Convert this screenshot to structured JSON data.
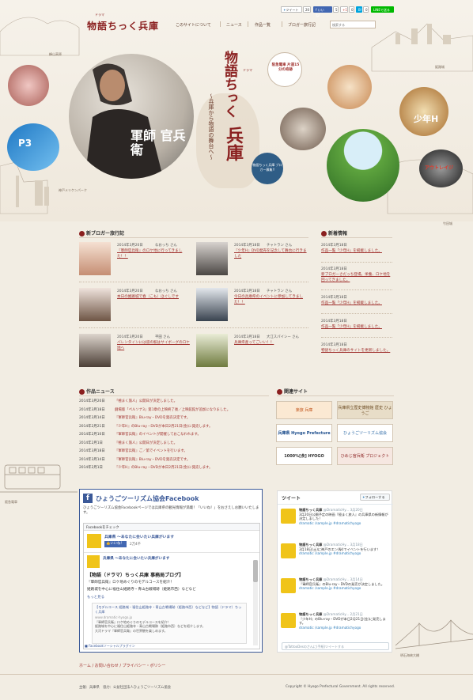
{
  "header": {
    "logo": "物語ちっく兵庫",
    "logo_ruby": "ドラマ",
    "nav": [
      "このサイトについて",
      "ニュース",
      "作品一覧",
      "ブロガー旅行記"
    ],
    "search_placeholder": "検索する",
    "social": {
      "tweet": "ツイート",
      "tweet_count": "20",
      "fb_like": "いいね！",
      "fb_count": "5",
      "gplus": "+1",
      "gplus_count": "0",
      "hatena": "B!",
      "hatena_count": "0",
      "line": "LINEで送る"
    }
  },
  "hero": {
    "title": "物語ちっく",
    "title_ruby": "ドラマ",
    "title_big": "兵庫",
    "subtitle": "〜兵庫から物語の舞台へ〜",
    "blog_badge": "物語ちっく兵庫 ブロガー募集!!",
    "main_title_art": "軍師 官兵衛",
    "poster_hankyu": "阪急電車 片道15分の奇跡",
    "poster_shonen": "少年H",
    "poster_outrage": "アウトレイジ",
    "poster_p3": "P3",
    "labels": {
      "rokko": "峰山高原",
      "himeji": "姫路城",
      "kobe": "神戸メリケンパーク",
      "takeda": "竹田城",
      "hankyu": "阪急電車",
      "akashi": "明石海峡大橋"
    }
  },
  "blogger": {
    "heading": "新ブロガー旅行記",
    "posts": [
      {
        "date": "2014年3月20日",
        "author": "なおっち さん",
        "title": "『軍師官兵衛』のロケ地に行ってきました！！"
      },
      {
        "date": "2014年3月18日",
        "author": "チャトラン さん",
        "title": "『少年H』DVD発売を記念して舞台に行きました"
      },
      {
        "date": "2014年3月20日",
        "author": "なおっち さん",
        "title": "本日の姫路城で春（こも）ほぐしです"
      },
      {
        "date": "2014年3月18日",
        "author": "チャトラン さん",
        "title": "今日の兵庫県のイベントに参加してきました！！"
      },
      {
        "date": "2014年3月20日",
        "author": "平田 さん",
        "title": "バレンタインには道の駅はサイボーグのロケ地へ"
      },
      {
        "date": "2014年3月18日",
        "author": "大江スパイシー さん",
        "title": "兵庫県産ってごいい！！"
      }
    ]
  },
  "info": {
    "heading": "新着情報",
    "items": [
      {
        "date": "2014年3月18日",
        "text": "作品一覧「少年H」を掲載しました。"
      },
      {
        "date": "2014年3月18日",
        "text": "新ブロガーさだっち登場。栄養、ロケ地を回ってきました。"
      },
      {
        "date": "2014年3月18日",
        "text": "作品一覧「少年H」を掲載しました。"
      },
      {
        "date": "2014年3月18日",
        "text": "作品一覧「少年H」を掲載しました。"
      },
      {
        "date": "2014年3月18日",
        "text": "物語ちっく兵庫のサイトを更新しました。"
      }
    ]
  },
  "news": {
    "heading": "作品ニュース",
    "rows": [
      {
        "date": "2014年3月20日",
        "text": "「極まく旅人」公開日が決定しました。"
      },
      {
        "date": "2014年3月18日",
        "text": "劇場版「ペルソナ3」第1章の上映終了後／上映館館が追加になりました。"
      },
      {
        "date": "2014年3月14日",
        "text": "『軍師官兵衛』Blu-ray・DVDを発売決定です。"
      },
      {
        "date": "2014年2月21日",
        "text": "『少年H』のBlu-ray・DVDが本日2月21日(金)に発売します。"
      },
      {
        "date": "2014年2月10日",
        "text": "『軍師官兵衛』のイベントが開催しておこなわれます。"
      },
      {
        "date": "2014年2月1日",
        "text": "『極まく旅人』公開日が決定しました。"
      },
      {
        "date": "2014年3月18日",
        "text": "『軍師官兵衛』ご／第でイベントを行います。"
      },
      {
        "date": "2014年3月14日",
        "text": "『軍師官兵衛』Blu-ray・DVDを発売決定です。"
      },
      {
        "date": "2014年2月1日",
        "text": "『少年H』のBlu-ray・DVDが本日2月21日(金)に発売します。"
      }
    ]
  },
  "links": {
    "heading": "関連サイト",
    "banners": [
      "楽旅 兵庫",
      "兵庫県立歴史博物館 歴史 ひょうご",
      "兵庫県 Hyogo Prefecture",
      "ひょうごツーリズム協会",
      "1000%[食] HYOGO",
      "ひめじ官兵衛 プロジェクト"
    ]
  },
  "facebook": {
    "title": "ひょうごツーリズム協会Facebook",
    "desc": "ひょうごツーリズム協会Facebookページでは兵庫県の観光情報が満載！「いいね！」をおさえしお願いいたします。",
    "plugin_head": "Facebookをチェック",
    "page_name": "兵庫県 〜あなたに会いたい兵庫がいます",
    "like_label": "いいね！",
    "like_count": "2万4千",
    "post_author": "兵庫県 〜あなたに会いたい兵庫がいます",
    "post_title": "【物語（ドラマ）ちっく兵庫 事務局ブログ】",
    "post_body1": "『軍師官兵衛』ロケ地めぐりのモデルコースを紹介！",
    "post_body2": "姫路城を中心に福住山姫路寺・青山古戦場跡（姫路市西）などなど",
    "more": "もっと見る",
    "card_title": "【モデルコース 姫路城・福住山姫路寺・青山古戦場跡（姫路市西）などなど】物語（ドラマ）ちっく兵庫",
    "card_url": "www.dramatic-hyogo.jp",
    "card_text1": "『軍師官兵衛』ロケ地めぐりのモデルコースを紹介！",
    "card_text2": "姫路城を中心に福住山姫路寺・青山古戦場跡（姫路市西）などを紹介します。",
    "card_text3": "大河ドラマ『軍師官兵衛』の世界観を楽しめます。",
    "footer": "Facebookソーシャルプラグイン"
  },
  "twitter": {
    "heading": "ツイート",
    "follow": "フォローする",
    "tweets": [
      {
        "name": "物語ちっく兵庫",
        "handle": "@DramaticHy...",
        "date": "3月20日",
        "text": "3月20日公開予定の映画『極まく旅人』の兵庫県の新情報が決定しました！",
        "link": "dramatic /sample.jp",
        "tag": "#dramatichyogo"
      },
      {
        "name": "物語ちっく兵庫",
        "handle": "@DramaticHy...",
        "date": "3月18日",
        "text": "3月18日(土)に神戸のエン(駅)でイベントを行います！",
        "link": "dramatic /sample.jp",
        "tag": "#dramatichyogo"
      },
      {
        "name": "物語ちっく兵庫",
        "handle": "@DramaticHy...",
        "date": "3月14日",
        "text": "『軍師官兵衛』のBlu-ray・DVDの発売が決定しました。",
        "link": "dramatic /sample.jp",
        "tag": "#dramatichyogo"
      },
      {
        "name": "物語ちっく兵庫",
        "handle": "@DramaticHy...",
        "date": "2月21日",
        "text": "『少年H』のBlu-ray・DVDが本日2月21日(金)に発売します。",
        "link": "dramatic /sample.jp",
        "tag": "#dramatichyogo"
      }
    ],
    "compose": "@TattooDesのさんに(手紙)ツイートする"
  },
  "footer": {
    "links": [
      "ホーム",
      "お問い合わせ",
      "プライバシー・ポリシー"
    ],
    "credit": "主催：兵庫県　協力：公益社団法人ひょうごツーリズム協会",
    "copyright": "Copyright © Hyogo Prefectural Government. All rights reserved."
  },
  "colors": {
    "brand": "#8a1f1f",
    "link": "#a0312e",
    "background": "#f2ede3",
    "facebook": "#3b5998"
  }
}
